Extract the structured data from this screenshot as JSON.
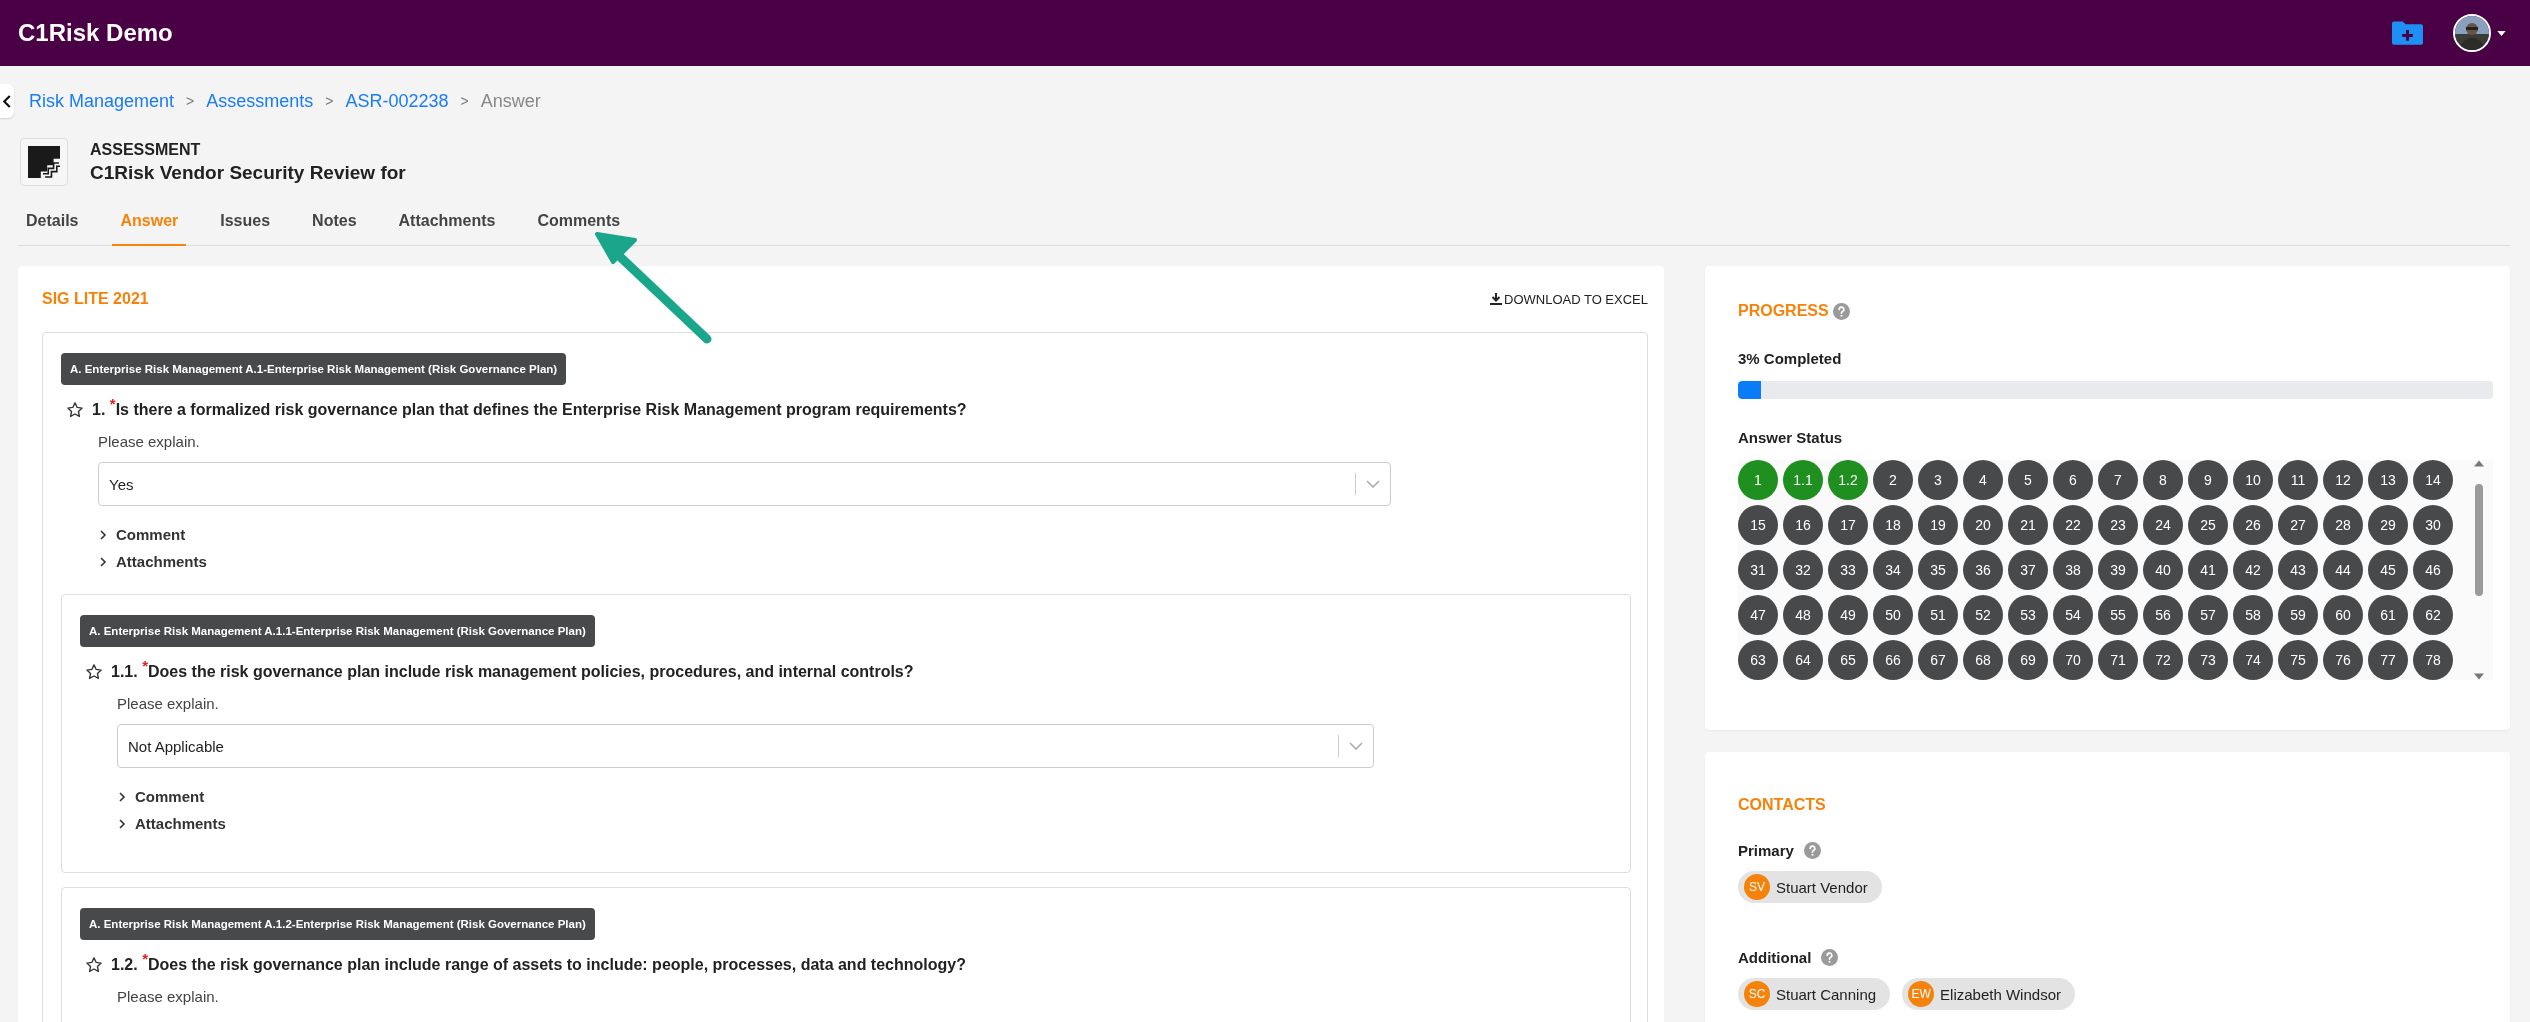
{
  "app": {
    "title": "C1Risk Demo"
  },
  "breadcrumb": [
    {
      "label": "Risk Management",
      "link": true
    },
    {
      "separator": ">",
      "label": "Assessments",
      "link": true
    },
    {
      "separator": ">",
      "label": "ASR-002238",
      "link": true
    },
    {
      "separator": ">",
      "label": "Answer",
      "link": false
    }
  ],
  "record": {
    "type": "ASSESSMENT",
    "title": "C1Risk Vendor Security Review for"
  },
  "tabs": [
    {
      "label": "Details",
      "selected": false
    },
    {
      "label": "Answer",
      "selected": true
    },
    {
      "label": "Issues",
      "selected": false
    },
    {
      "label": "Notes",
      "selected": false
    },
    {
      "label": "Attachments",
      "selected": false
    },
    {
      "label": "Comments",
      "selected": false
    }
  ],
  "questionnaire": {
    "title": "SIG LITE 2021",
    "download": "DOWNLOAD TO EXCEL",
    "questions": [
      {
        "tag": "A. Enterprise Risk Management A.1-Enterprise Risk Management (Risk Governance Plan)",
        "number": "1.",
        "required_mark": "*",
        "text": "Is there a formalized risk governance plan that defines the Enterprise Risk Management program requirements?",
        "prompt": "Please explain.",
        "answer": "Yes",
        "sections": [
          "Comment",
          "Attachments"
        ],
        "children": [
          {
            "tag": "A. Enterprise Risk Management A.1.1-Enterprise Risk Management (Risk Governance Plan)",
            "number": "1.1.",
            "required_mark": "*",
            "text": "Does the risk governance plan include risk management policies, procedures, and internal controls?",
            "prompt": "Please explain.",
            "answer": "Not Applicable",
            "sections": [
              "Comment",
              "Attachments"
            ]
          },
          {
            "tag": "A. Enterprise Risk Management A.1.2-Enterprise Risk Management (Risk Governance Plan)",
            "number": "1.2.",
            "required_mark": "*",
            "text": "Does the risk governance plan include range of assets to include: people, processes, data and technology?",
            "prompt": "Please explain."
          }
        ]
      }
    ]
  },
  "progress": {
    "title": "PROGRESS",
    "completed": "3% Completed",
    "level": 0.03,
    "status_title": "Answer Status",
    "answers": [
      {
        "label": "1",
        "answered": true
      },
      {
        "label": "1.1",
        "answered": true
      },
      {
        "label": "1.2",
        "answered": true
      },
      {
        "label": "2",
        "answered": false
      },
      {
        "label": "3",
        "answered": false
      },
      {
        "label": "4",
        "answered": false
      },
      {
        "label": "5",
        "answered": false
      },
      {
        "label": "6",
        "answered": false
      },
      {
        "label": "7",
        "answered": false
      },
      {
        "label": "8",
        "answered": false
      },
      {
        "label": "9",
        "answered": false
      },
      {
        "label": "10",
        "answered": false
      },
      {
        "label": "11",
        "answered": false
      },
      {
        "label": "12",
        "answered": false
      },
      {
        "label": "13",
        "answered": false
      },
      {
        "label": "14",
        "answered": false
      },
      {
        "label": "15",
        "answered": false
      },
      {
        "label": "16",
        "answered": false
      },
      {
        "label": "17",
        "answered": false
      },
      {
        "label": "18",
        "answered": false
      },
      {
        "label": "19",
        "answered": false
      },
      {
        "label": "20",
        "answered": false
      },
      {
        "label": "21",
        "answered": false
      },
      {
        "label": "22",
        "answered": false
      },
      {
        "label": "23",
        "answered": false
      },
      {
        "label": "24",
        "answered": false
      },
      {
        "label": "25",
        "answered": false
      },
      {
        "label": "26",
        "answered": false
      },
      {
        "label": "27",
        "answered": false
      },
      {
        "label": "28",
        "answered": false
      },
      {
        "label": "29",
        "answered": false
      },
      {
        "label": "30",
        "answered": false
      },
      {
        "label": "31",
        "answered": false
      },
      {
        "label": "32",
        "answered": false
      },
      {
        "label": "33",
        "answered": false
      },
      {
        "label": "34",
        "answered": false
      },
      {
        "label": "35",
        "answered": false
      },
      {
        "label": "36",
        "answered": false
      },
      {
        "label": "37",
        "answered": false
      },
      {
        "label": "38",
        "answered": false
      },
      {
        "label": "39",
        "answered": false
      },
      {
        "label": "40",
        "answered": false
      },
      {
        "label": "41",
        "answered": false
      },
      {
        "label": "42",
        "answered": false
      },
      {
        "label": "43",
        "answered": false
      },
      {
        "label": "44",
        "answered": false
      },
      {
        "label": "45",
        "answered": false
      },
      {
        "label": "46",
        "answered": false
      },
      {
        "label": "47",
        "answered": false
      },
      {
        "label": "48",
        "answered": false
      },
      {
        "label": "49",
        "answered": false
      },
      {
        "label": "50",
        "answered": false
      },
      {
        "label": "51",
        "answered": false
      },
      {
        "label": "52",
        "answered": false
      },
      {
        "label": "53",
        "answered": false
      },
      {
        "label": "54",
        "answered": false
      },
      {
        "label": "55",
        "answered": false
      },
      {
        "label": "56",
        "answered": false
      },
      {
        "label": "57",
        "answered": false
      },
      {
        "label": "58",
        "answered": false
      },
      {
        "label": "59",
        "answered": false
      },
      {
        "label": "60",
        "answered": false
      },
      {
        "label": "61",
        "answered": false
      },
      {
        "label": "62",
        "answered": false
      },
      {
        "label": "63",
        "answered": false
      },
      {
        "label": "64",
        "answered": false
      },
      {
        "label": "65",
        "answered": false
      },
      {
        "label": "66",
        "answered": false
      },
      {
        "label": "67",
        "answered": false
      },
      {
        "label": "68",
        "answered": false
      },
      {
        "label": "69",
        "answered": false
      },
      {
        "label": "70",
        "answered": false
      },
      {
        "label": "71",
        "answered": false
      },
      {
        "label": "72",
        "answered": false
      },
      {
        "label": "73",
        "answered": false
      },
      {
        "label": "74",
        "answered": false
      },
      {
        "label": "75",
        "answered": false
      },
      {
        "label": "76",
        "answered": false
      },
      {
        "label": "77",
        "answered": false
      },
      {
        "label": "78",
        "answered": false
      }
    ]
  },
  "contacts": {
    "title": "CONTACTS",
    "groups": [
      {
        "label": "Primary",
        "people": [
          {
            "initials": "SV",
            "name": "Stuart Vendor"
          }
        ]
      },
      {
        "label": "Additional",
        "people": [
          {
            "initials": "SC",
            "name": "Stuart Canning"
          },
          {
            "initials": "EW",
            "name": "Elizabeth Windsor"
          }
        ]
      }
    ]
  }
}
